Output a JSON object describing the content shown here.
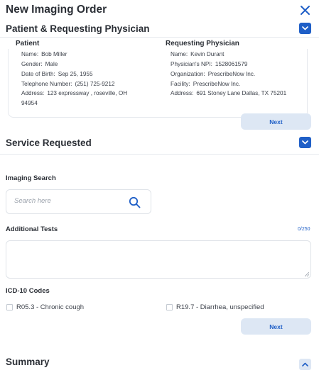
{
  "header": {
    "title": "New Imaging Order"
  },
  "patient_section": {
    "title": "Patient & Requesting Physician",
    "patient": {
      "heading": "Patient",
      "fields": [
        {
          "label": "Name:",
          "value": "Bob Miller"
        },
        {
          "label": "Gender:",
          "value": "Male"
        },
        {
          "label": "Date of Birth:",
          "value": "Sep 25, 1955"
        },
        {
          "label": "Telephone Number:",
          "value": "(251) 725-9212"
        },
        {
          "label": "Address:",
          "value": "123 expressway , roseville, OH"
        }
      ],
      "address_line2": "94954"
    },
    "physician": {
      "heading": "Requesting Physician",
      "fields": [
        {
          "label": "Name:",
          "value": "Kevin Durant"
        },
        {
          "label": "Physician's NPI:",
          "value": "1528061579"
        },
        {
          "label": "Organization:",
          "value": "PrescribeNow Inc."
        },
        {
          "label": "Facility:",
          "value": "PrescribeNow Inc."
        },
        {
          "label": "Address:",
          "value": "691 Stoney Lane Dallas, TX 75201"
        }
      ]
    },
    "next_label": "Next"
  },
  "service_section": {
    "title": "Service Requested",
    "imaging_search": {
      "label": "Imaging Search",
      "placeholder": "Search here"
    },
    "additional_tests": {
      "label": "Additional Tests",
      "counter": "0/250"
    },
    "icd10": {
      "label": "ICD-10 Codes",
      "codes": [
        {
          "text": "R05.3 - Chronic cough",
          "checked": false
        },
        {
          "text": "R19.7 - Diarrhea, unspecified",
          "checked": false
        }
      ]
    },
    "next_label": "Next"
  },
  "summary_section": {
    "title": "Summary"
  },
  "icons": {
    "close": "close-icon",
    "collapse": "chevron-down-icon",
    "expand": "chevron-up-icon",
    "search": "search-icon"
  },
  "colors": {
    "accent": "#1f5fc7",
    "button_bg": "#dde7f4",
    "text": "#2b2f36",
    "border": "#e6e9ee"
  }
}
